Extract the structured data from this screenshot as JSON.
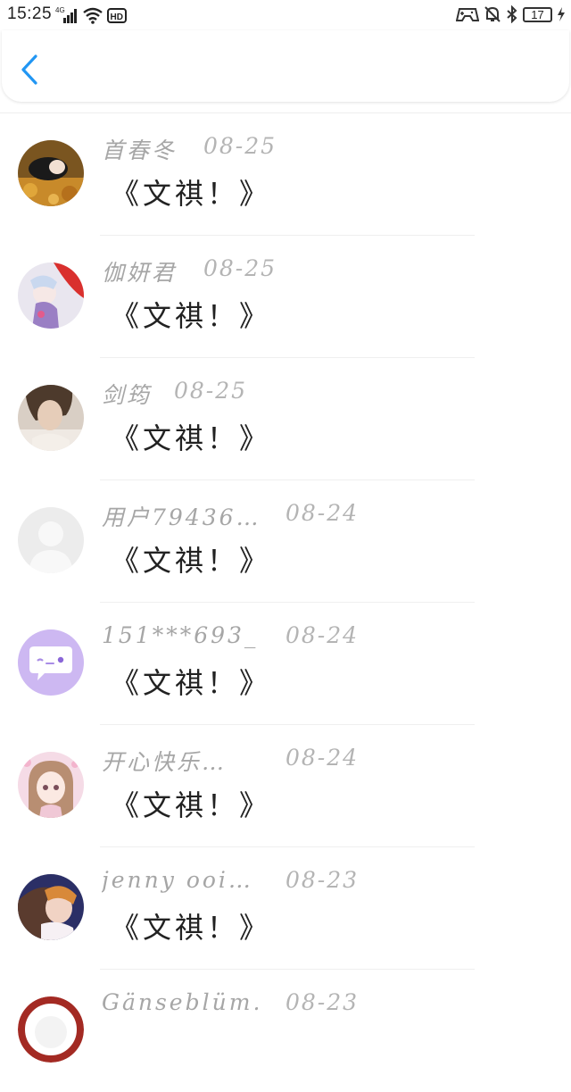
{
  "status_bar": {
    "time": "15:25",
    "network": "4G",
    "hd_label": "HD",
    "battery": "17"
  },
  "nav": {
    "back_icon": "chevron-left-icon",
    "accent_color": "#2196f3"
  },
  "comments": [
    {
      "name": "首春冬",
      "date": "08-25",
      "text": "《文祺！》",
      "avatar": "avatar-photo-autumn"
    },
    {
      "name": "伽妍君",
      "date": "08-25",
      "text": "《文祺！》",
      "avatar": "avatar-anime-red"
    },
    {
      "name": "剑筠",
      "date": "08-25",
      "text": "《文祺！》",
      "avatar": "avatar-photo-portrait"
    },
    {
      "name": "用户79436…",
      "date": "08-24",
      "text": "《文祺！》",
      "avatar": "avatar-default-user"
    },
    {
      "name": "151***693_…",
      "date": "08-24",
      "text": "《文祺！》",
      "avatar": "avatar-chat-bubble"
    },
    {
      "name": "开心快乐…",
      "date": "08-24",
      "text": "《文祺！》",
      "avatar": "avatar-anime-girl"
    },
    {
      "name": "jenny ooi…",
      "date": "08-23",
      "text": "《文祺！》",
      "avatar": "avatar-anime-couple"
    },
    {
      "name": "Gänseblüm…",
      "date": "08-23",
      "text": "",
      "avatar": "avatar-red-partial"
    }
  ]
}
